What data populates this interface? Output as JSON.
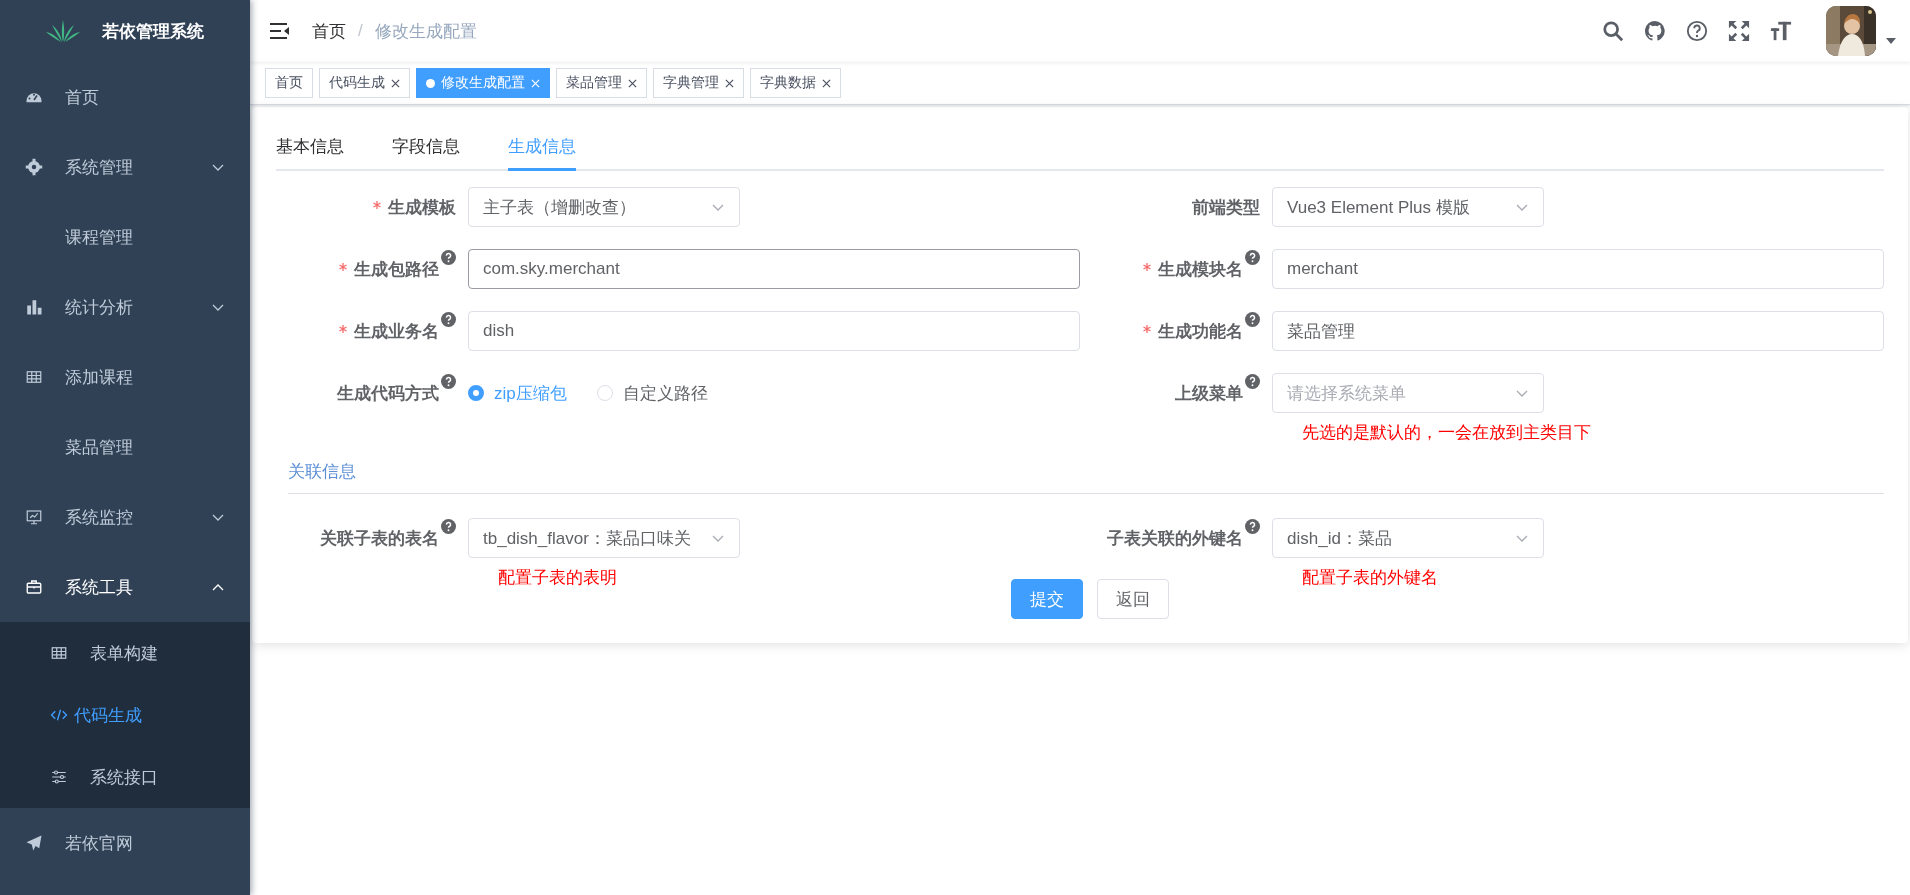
{
  "sidebar": {
    "title": "若依管理系统",
    "items": [
      {
        "label": "首页",
        "kind": "dashboard",
        "selected": false
      },
      {
        "label": "系统管理",
        "kind": "gear",
        "expanded": false,
        "selected": false
      },
      {
        "label": "课程管理",
        "kind": "none",
        "selected": false
      },
      {
        "label": "统计分析",
        "kind": "chart",
        "expanded": false,
        "selected": false
      },
      {
        "label": "添加课程",
        "kind": "table",
        "selected": false
      },
      {
        "label": "菜品管理",
        "kind": "none",
        "selected": false
      },
      {
        "label": "系统监控",
        "kind": "monitor",
        "expanded": false,
        "selected": false
      },
      {
        "label": "系统工具",
        "kind": "toolbox",
        "expanded": true,
        "selected": false,
        "children": [
          {
            "label": "表单构建",
            "kind": "table",
            "selected": false
          },
          {
            "label": "代码生成",
            "kind": "code",
            "selected": true
          },
          {
            "label": "系统接口",
            "kind": "sliders",
            "selected": false
          }
        ]
      },
      {
        "label": "若依官网",
        "kind": "send",
        "selected": false
      }
    ]
  },
  "header": {
    "breadcrumb": [
      "首页",
      "修改生成配置"
    ],
    "separator": "/"
  },
  "tags": [
    {
      "label": "首页",
      "selected": false,
      "closable": false
    },
    {
      "label": "代码生成",
      "selected": false,
      "closable": true
    },
    {
      "label": "修改生成配置",
      "selected": true,
      "closable": true
    },
    {
      "label": "菜品管理",
      "selected": false,
      "closable": true
    },
    {
      "label": "字典管理",
      "selected": false,
      "closable": true
    },
    {
      "label": "字典数据",
      "selected": false,
      "closable": true
    }
  ],
  "tabs": [
    {
      "label": "基本信息",
      "selected": false
    },
    {
      "label": "字段信息",
      "selected": false
    },
    {
      "label": "生成信息",
      "selected": true
    }
  ],
  "form": {
    "rows": [
      [
        {
          "label": "生成模板",
          "required": true,
          "kind": "select",
          "value": "主子表（增删改查）"
        },
        {
          "label": "前端类型",
          "kind": "select",
          "value": "Vue3 Element Plus 模版"
        }
      ],
      [
        {
          "label": "生成包路径",
          "required": true,
          "help": true,
          "kind": "input",
          "value": "com.sky.merchant",
          "focused": true
        },
        {
          "label": "生成模块名",
          "required": true,
          "help": true,
          "kind": "input",
          "value": "merchant",
          "focused": false
        }
      ],
      [
        {
          "label": "生成业务名",
          "required": true,
          "help": true,
          "kind": "input",
          "value": "dish",
          "focused": false
        },
        {
          "label": "生成功能名",
          "required": true,
          "help": true,
          "kind": "input",
          "value": "菜品管理",
          "focused": false
        }
      ],
      [
        {
          "label": "生成代码方式",
          "help": true,
          "kind": "radio",
          "options": [
            {
              "label": "zip压缩包",
              "selected": true
            },
            {
              "label": "自定义路径",
              "selected": false
            }
          ]
        },
        {
          "label": "上级菜单",
          "help": true,
          "kind": "select",
          "placeholder": "请选择系统菜单",
          "note": "先选的是默认的，一会在放到主类目下"
        }
      ]
    ],
    "section": "关联信息",
    "sub_rows": [
      [
        {
          "label": "关联子表的表名",
          "help": true,
          "kind": "select",
          "value": "tb_dish_flavor：菜品口味关",
          "note": "配置子表的表明"
        },
        {
          "label": "子表关联的外键名",
          "help": true,
          "kind": "select",
          "value": "dish_id：菜品",
          "note": "配置子表的外键名"
        }
      ]
    ],
    "buttons": [
      {
        "label": "提交",
        "kind": "primary"
      },
      {
        "label": "返回",
        "kind": "default"
      }
    ]
  }
}
